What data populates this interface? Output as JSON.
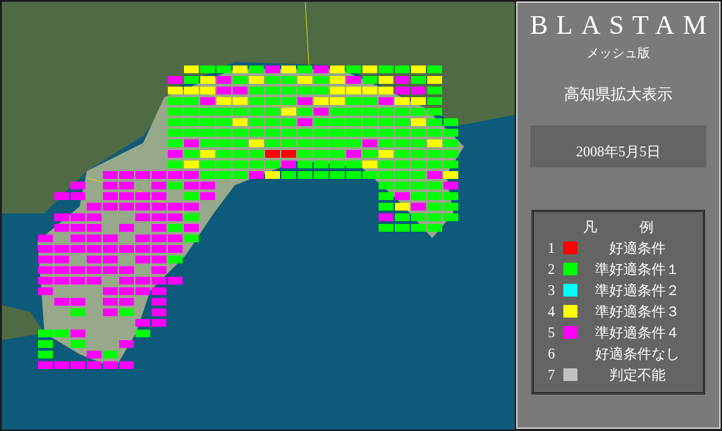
{
  "panel": {
    "title": "BLASTAM",
    "subtitle": "メッシュ版",
    "view": "高知県拡大表示",
    "date": "2008年5月5日"
  },
  "legend": {
    "heading": [
      "凡",
      "例"
    ],
    "items": [
      {
        "number": "1",
        "label": "好適条件",
        "color": "#ff0000"
      },
      {
        "number": "2",
        "label": "準好適条件１",
        "color": "#00ff00"
      },
      {
        "number": "3",
        "label": "準好適条件２",
        "color": "#00ffff"
      },
      {
        "number": "4",
        "label": "準好適条件３",
        "color": "#ffff00"
      },
      {
        "number": "5",
        "label": "準好適条件４",
        "color": "#ff00ff"
      },
      {
        "number": "6",
        "label": "好適条件なし"
      },
      {
        "number": "7",
        "label": "判定不能",
        "color": "#c0c0c0"
      }
    ]
  }
}
